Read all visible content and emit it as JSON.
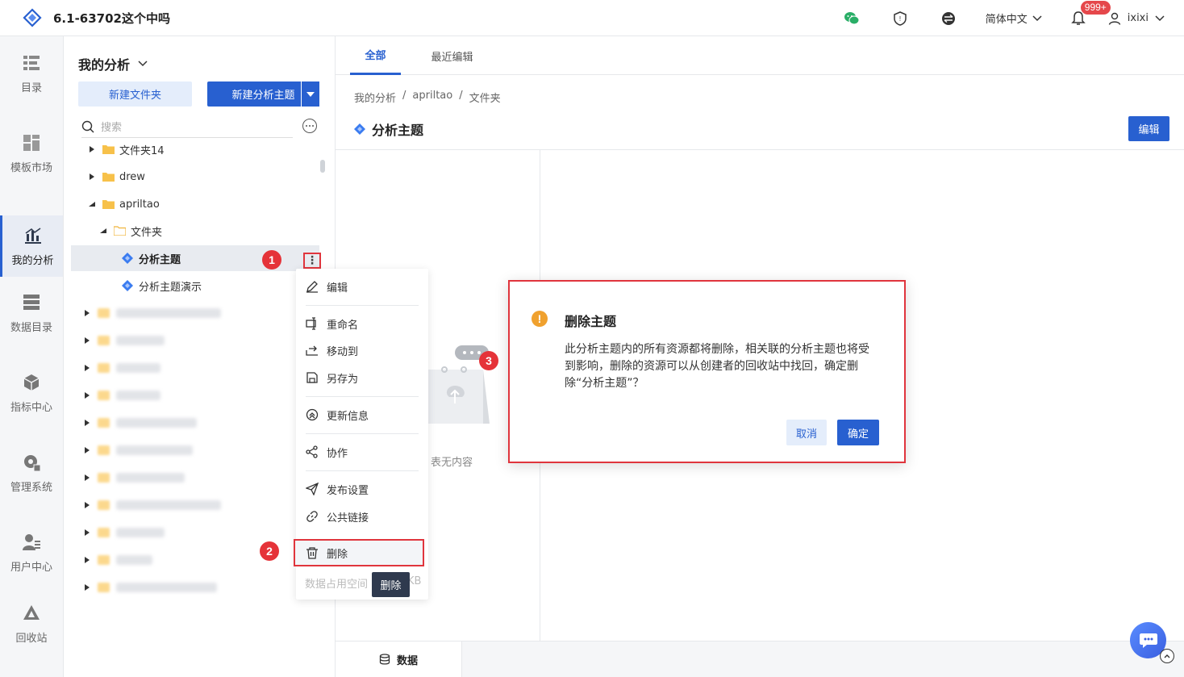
{
  "app": {
    "title": "6.1-63702这个中吗"
  },
  "topbar": {
    "language": "简体中文",
    "notification_badge": "999+",
    "username": "ixixi"
  },
  "leftnav": {
    "items": [
      {
        "label": "目录",
        "icon": "catalog-icon"
      },
      {
        "label": "模板市场",
        "icon": "template-market-icon"
      },
      {
        "label": "我的分析",
        "icon": "my-analysis-icon",
        "active": true
      },
      {
        "label": "数据目录",
        "icon": "data-catalog-icon"
      },
      {
        "label": "指标中心",
        "icon": "metrics-center-icon"
      },
      {
        "label": "管理系统",
        "icon": "admin-system-icon"
      },
      {
        "label": "用户中心",
        "icon": "user-center-icon"
      },
      {
        "label": "回收站",
        "icon": "recycle-bin-icon"
      }
    ]
  },
  "tree": {
    "header": "我的分析",
    "new_folder": "新建文件夹",
    "new_topic": "新建分析主题",
    "search_placeholder": "搜索",
    "rows": [
      {
        "label": "文件夹14",
        "type": "folder"
      },
      {
        "label": "drew",
        "type": "folder"
      },
      {
        "label": "apriltao",
        "type": "folder-open"
      },
      {
        "label": "文件夹",
        "type": "folder-open"
      },
      {
        "label": "分析主题",
        "type": "topic",
        "selected": true
      },
      {
        "label": "分析主题演示",
        "type": "topic"
      }
    ]
  },
  "context_menu": {
    "items": [
      {
        "label": "编辑",
        "icon": "edit-icon"
      },
      {
        "label": "重命名",
        "icon": "rename-icon"
      },
      {
        "label": "移动到",
        "icon": "move-icon"
      },
      {
        "label": "另存为",
        "icon": "save-as-icon"
      },
      {
        "label": "更新信息",
        "icon": "update-info-icon"
      },
      {
        "label": "协作",
        "icon": "collaborate-icon"
      },
      {
        "label": "发布设置",
        "icon": "publish-icon"
      },
      {
        "label": "公共链接",
        "icon": "link-icon"
      },
      {
        "label": "删除",
        "icon": "trash-icon"
      }
    ],
    "footer": "数据占用空间",
    "footer_tail": "KB",
    "tooltip": "删除"
  },
  "steps": [
    "1",
    "2",
    "3"
  ],
  "main": {
    "tabs": [
      "全部",
      "最近编辑"
    ],
    "breadcrumb": [
      "我的分析",
      "/",
      "apriltao",
      "/",
      "文件夹"
    ],
    "title": "分析主题",
    "edit_button": "编辑",
    "empty_text": "表无内容",
    "bottom_tab": "数据"
  },
  "dialog": {
    "title": "删除主题",
    "body": "此分析主题内的所有资源都将删除，相关联的分析主题也将受到影响，删除的资源可以从创建者的回收站中找回，确定删除“分析主题”？",
    "cancel": "取消",
    "confirm": "确定"
  },
  "colors": {
    "primary": "#2860d0",
    "highlight_red": "#e0353d",
    "warning": "#f0a12e",
    "badge": "#e5474b"
  }
}
